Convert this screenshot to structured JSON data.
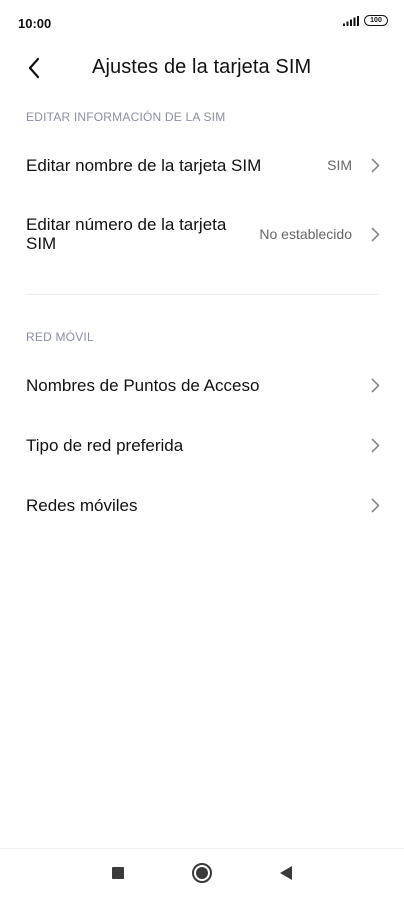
{
  "status_bar": {
    "time": "10:00",
    "battery": "100",
    "icons": [
      "signal-icon",
      "battery-icon"
    ]
  },
  "header": {
    "back_icon": "chevron-left-icon",
    "title": "Ajustes de la tarjeta SIM"
  },
  "sections": [
    {
      "header": "EDITAR INFORMACIÓN DE LA SIM",
      "items": [
        {
          "label": "Editar nombre de la tarjeta SIM",
          "value": "SIM"
        },
        {
          "label": "Editar número de la tarjeta SIM",
          "value": "No establecido"
        }
      ]
    },
    {
      "header": "RED MÓVIL",
      "items": [
        {
          "label": "Nombres de Puntos de Acceso",
          "value": ""
        },
        {
          "label": "Tipo de red preferida",
          "value": ""
        },
        {
          "label": "Redes móviles",
          "value": ""
        }
      ]
    }
  ],
  "nav_bar": {
    "icons": [
      "recents-square-icon",
      "home-circle-icon",
      "back-triangle-icon"
    ]
  },
  "colors": {
    "section_header": "#8a8fa3",
    "text": "#111111",
    "secondary_text": "#666666",
    "chevron": "#888888",
    "divider": "#ececec"
  }
}
